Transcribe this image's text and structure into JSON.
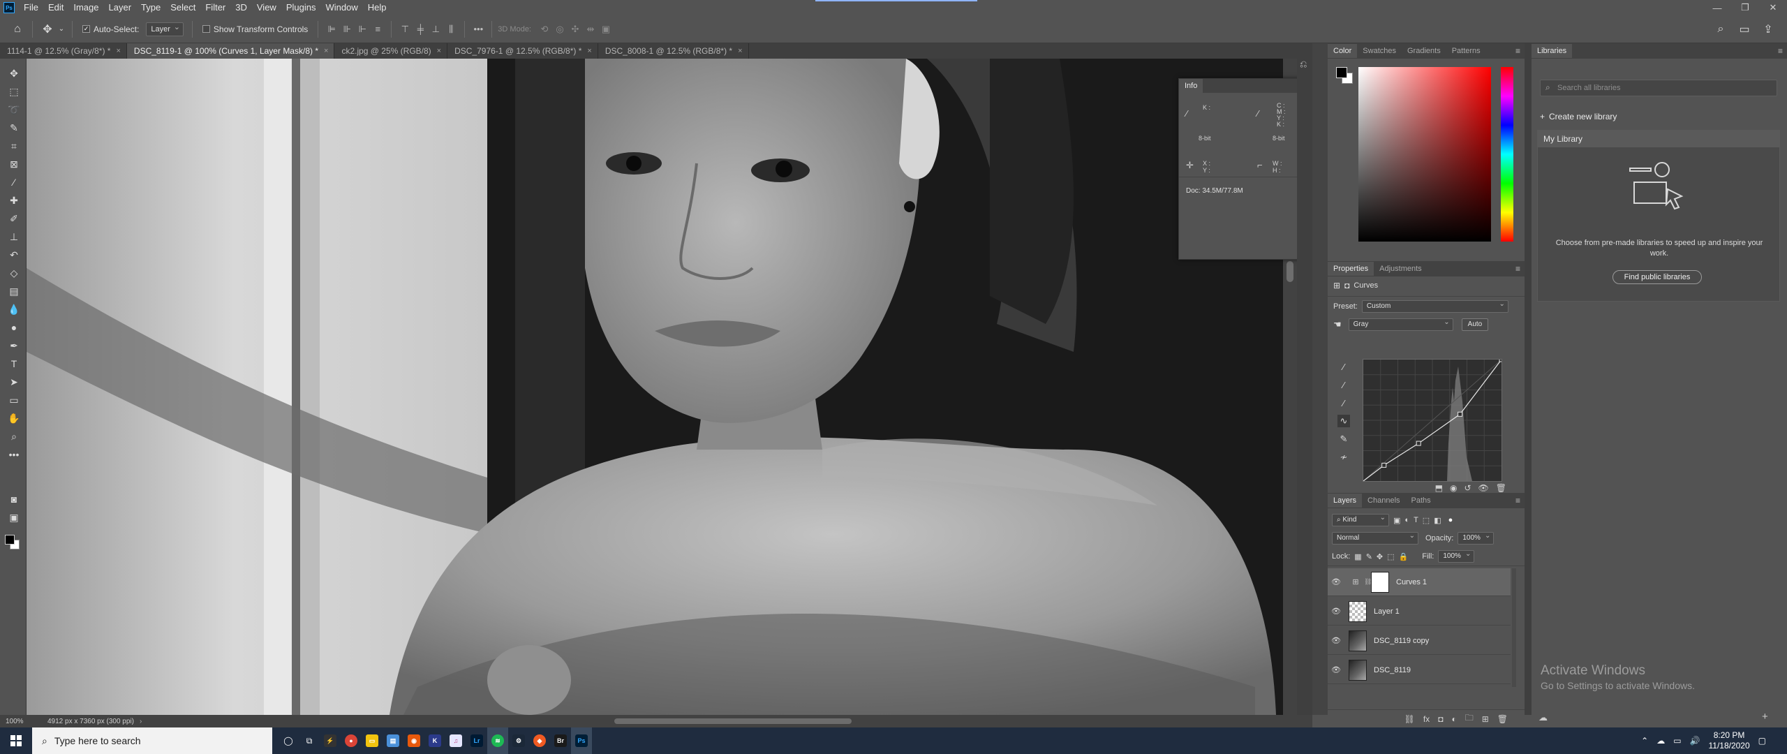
{
  "app": {
    "logo": "Ps",
    "menu": [
      "File",
      "Edit",
      "Image",
      "Layer",
      "Type",
      "Select",
      "Filter",
      "3D",
      "View",
      "Plugins",
      "Window",
      "Help"
    ]
  },
  "options": {
    "auto_select_label": "Auto-Select:",
    "auto_select_value": "Layer",
    "transform_label": "Show Transform Controls",
    "mode_3d": "3D Mode:"
  },
  "tabs": [
    {
      "label": "1114-1 @ 12.5% (Gray/8*) *",
      "active": false
    },
    {
      "label": "DSC_8119-1 @ 100% (Curves 1, Layer Mask/8) *",
      "active": true
    },
    {
      "label": "ck2.jpg @ 25% (RGB/8)",
      "active": false
    },
    {
      "label": "DSC_7976-1 @ 12.5% (RGB/8*) *",
      "active": false
    },
    {
      "label": "DSC_8008-1 @ 12.5% (RGB/8*) *",
      "active": false
    }
  ],
  "info": {
    "tab": "Info",
    "k_label": "K :",
    "cmyk": "C :\nM :\nY :\nK :",
    "bit_left": "8-bit",
    "bit_right": "8-bit",
    "xy": "X :\nY :",
    "wh": "W :\nH :",
    "doc": "Doc: 34.5M/77.8M"
  },
  "color_panel": {
    "tabs": [
      "Color",
      "Swatches",
      "Gradients",
      "Patterns"
    ]
  },
  "properties": {
    "tabs": [
      "Properties",
      "Adjustments"
    ],
    "adjustment_name": "Curves",
    "preset_label": "Preset:",
    "preset_value": "Custom",
    "channel_value": "Gray",
    "auto_label": "Auto",
    "curve_points": [
      [
        0,
        0
      ],
      [
        0.15,
        0.13
      ],
      [
        0.4,
        0.31
      ],
      [
        0.7,
        0.55
      ],
      [
        1,
        1
      ]
    ]
  },
  "layers": {
    "tabs": [
      "Layers",
      "Channels",
      "Paths"
    ],
    "filter_label": "Kind",
    "blend_mode": "Normal",
    "opacity_label": "Opacity:",
    "opacity_value": "100%",
    "lock_label": "Lock:",
    "fill_label": "Fill:",
    "fill_value": "100%",
    "items": [
      {
        "name": "Curves 1",
        "selected": true
      },
      {
        "name": "Layer 1",
        "selected": false
      },
      {
        "name": "DSC_8119 copy",
        "selected": false
      },
      {
        "name": "DSC_8119",
        "selected": false
      }
    ]
  },
  "libraries": {
    "tab": "Libraries",
    "search_placeholder": "Search all libraries",
    "create_label": "Create new library",
    "library_name": "My Library",
    "description": "Choose from pre-made libraries to speed up and inspire your work.",
    "find_button": "Find public libraries"
  },
  "status": {
    "zoom": "100%",
    "doc_info": "4912 px x 7360 px (300 ppi)"
  },
  "watermark": {
    "line1": "Activate Windows",
    "line2": "Go to Settings to activate Windows."
  },
  "taskbar": {
    "search_placeholder": "Type here to search",
    "time": "8:20 PM",
    "date": "11/18/2020"
  }
}
